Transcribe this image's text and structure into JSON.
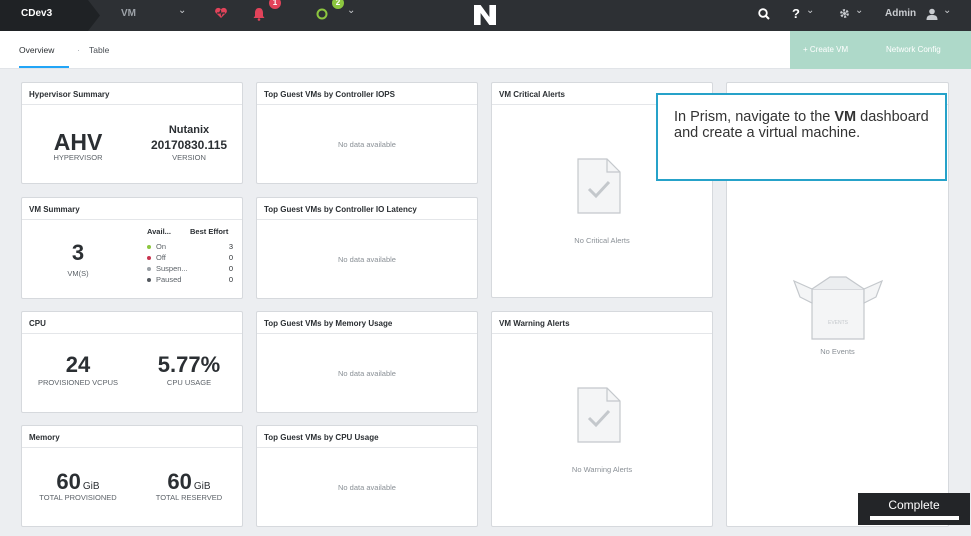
{
  "topbar": {
    "cluster_name": "CDev3",
    "menu": "VM",
    "menu_chevron": "⌄",
    "alerts_count": "1",
    "tasks_count": "2",
    "user": "Admin",
    "icons": [
      "heart-icon",
      "bell-icon",
      "circle-icon",
      "search-icon",
      "help-icon",
      "gear-icon",
      "user-icon"
    ]
  },
  "subnav": {
    "tabs": [
      "Overview",
      "Table"
    ],
    "separator": "·",
    "create_vm": "+ Create VM",
    "network_config": "Network Config"
  },
  "hypervisor": {
    "title": "Hypervisor Summary",
    "type": "AHV",
    "type_label": "HYPERVISOR",
    "vendor": "Nutanix",
    "version": "20170830.115",
    "version_label": "VERSION"
  },
  "vm_summary": {
    "title": "VM Summary",
    "count": "3",
    "count_label": "VM(S)",
    "col1": "Avail...",
    "col2": "Best Effort",
    "rows": [
      {
        "label": "On",
        "value": "3",
        "color": "#8cc63f"
      },
      {
        "label": "Off",
        "value": "0",
        "color": "#c8344f"
      },
      {
        "label": "Suspen...",
        "value": "0",
        "color": "#9aa0a6"
      },
      {
        "label": "Paused",
        "value": "0",
        "color": "#555a60"
      }
    ]
  },
  "cpu": {
    "title": "CPU",
    "vcpus": "24",
    "vcpus_label": "PROVISIONED VCPUS",
    "usage": "5.77%",
    "usage_label": "CPU USAGE"
  },
  "memory": {
    "title": "Memory",
    "provisioned": "60",
    "provisioned_unit": "GiB",
    "provisioned_label": "TOTAL PROVISIONED",
    "reserved": "60",
    "reserved_unit": "GiB",
    "reserved_label": "TOTAL RESERVED"
  },
  "top_vms": [
    {
      "title": "Top Guest VMs by Controller IOPS",
      "message": "No data available"
    },
    {
      "title": "Top Guest VMs by Controller IO Latency",
      "message": "No data available"
    },
    {
      "title": "Top Guest VMs by Memory Usage",
      "message": "No data available"
    },
    {
      "title": "Top Guest VMs by CPU Usage",
      "message": "No data available"
    }
  ],
  "alerts": {
    "critical_title": "VM Critical Alerts",
    "critical_message": "No Critical Alerts",
    "warning_title": "VM Warning Alerts",
    "warning_message": "No Warning Alerts"
  },
  "events": {
    "box_label": "EVENTS",
    "message": "No Events"
  },
  "tooltip": {
    "text_before": "In Prism, navigate to the ",
    "highlight": "VM",
    "text_after": " dashboard and create a virtual machine."
  },
  "complete_label": "Complete"
}
